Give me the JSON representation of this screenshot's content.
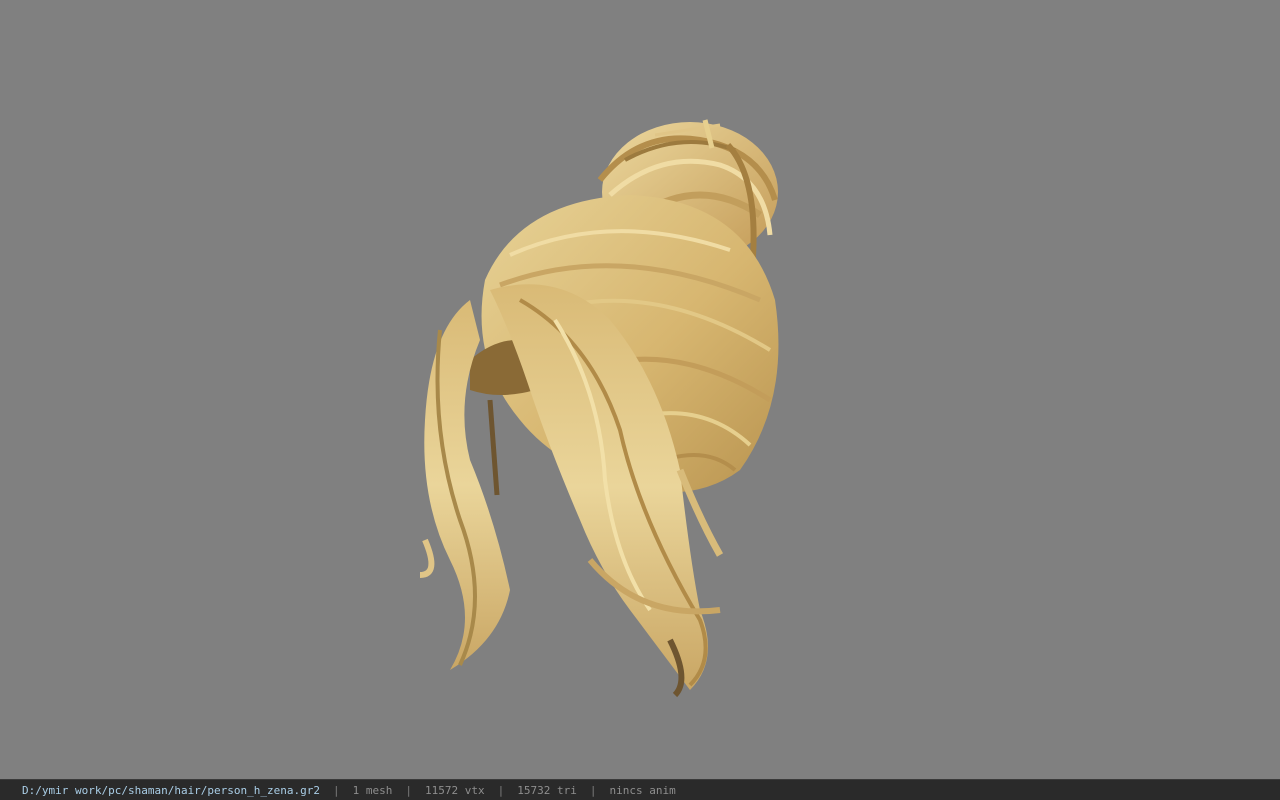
{
  "viewport": {
    "background_color": "#808080",
    "model_name": "person_h_zena",
    "model_colors": {
      "light": "#e6cf8e",
      "mid": "#d4b46c",
      "dark": "#a8894a",
      "shadow": "#6e5530"
    }
  },
  "statusbar": {
    "file_path": "D:/ymir work/pc/shaman/hair/person_h_zena.gr2",
    "separator": "|",
    "mesh_count": "1 mesh",
    "vertex_count": "11572 vtx",
    "triangle_count": "15732 tri",
    "anim_status": "nincs anim",
    "colors": {
      "path": "#a9cde6",
      "stats": "#8e8e8e",
      "background": "#2a2a2a"
    }
  }
}
